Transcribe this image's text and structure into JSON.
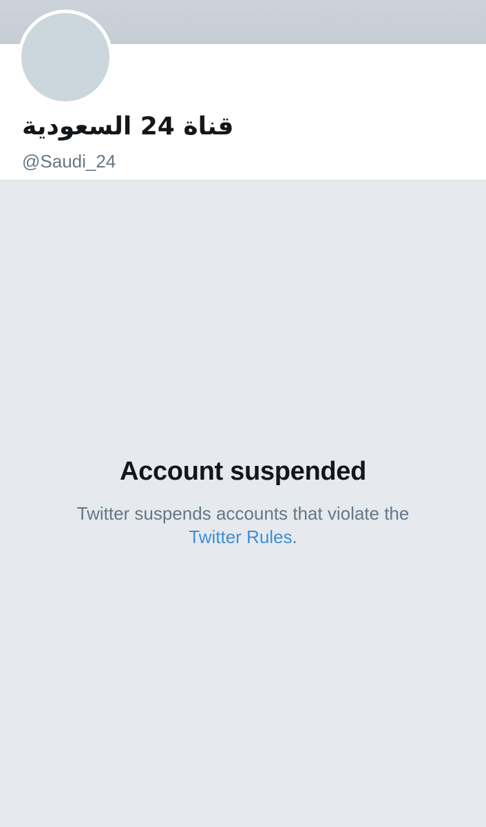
{
  "profile": {
    "display_name": "قناة 24 السعودية",
    "handle": "@Saudi_24"
  },
  "suspension": {
    "title": "Account suspended",
    "message": "Twitter suspends accounts that violate the",
    "link_text": "Twitter Rules",
    "trailing": "."
  },
  "colors": {
    "banner": "#c9cfd7",
    "avatar": "#ccd6dd",
    "background": "#e6e9ee",
    "link": "#3f8ed4",
    "secondary_text": "#657786",
    "primary_text": "#14171a"
  }
}
